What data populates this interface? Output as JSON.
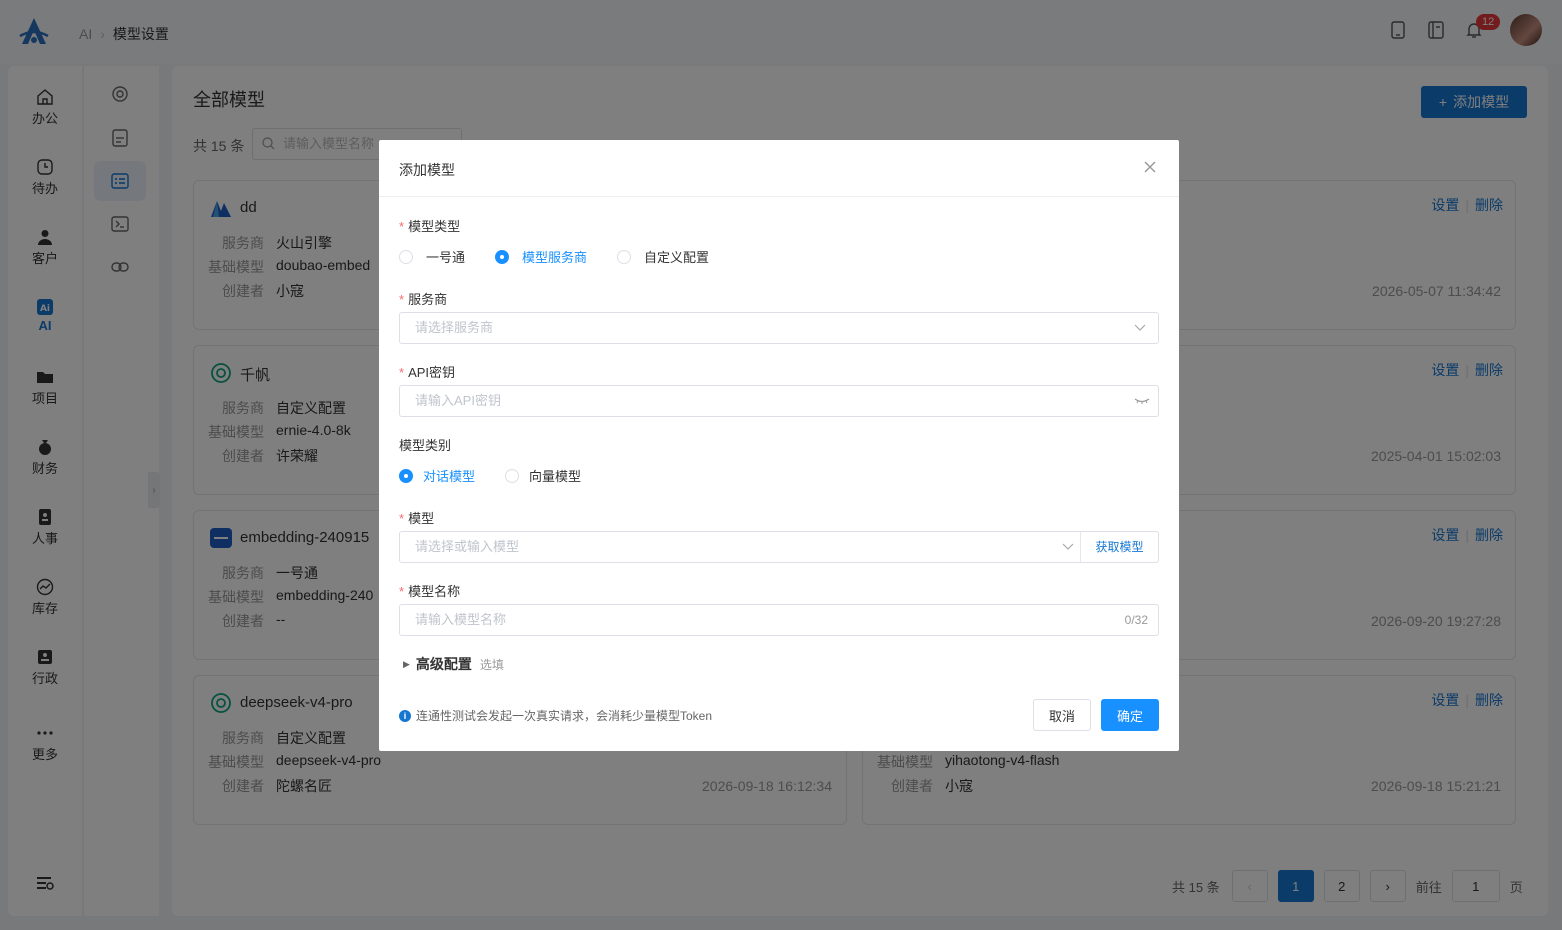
{
  "breadcrumb": {
    "root": "AI",
    "current": "模型设置"
  },
  "notifications": {
    "count": "12"
  },
  "nav": [
    {
      "label": "办公",
      "icon": "home-icon"
    },
    {
      "label": "待办",
      "icon": "clock-icon"
    },
    {
      "label": "客户",
      "icon": "user-icon"
    },
    {
      "label": "AI",
      "icon": "ai-icon"
    },
    {
      "label": "项目",
      "icon": "folder-icon"
    },
    {
      "label": "财务",
      "icon": "money-bag-icon"
    },
    {
      "label": "人事",
      "icon": "badge-icon"
    },
    {
      "label": "库存",
      "icon": "chart-icon"
    },
    {
      "label": "行政",
      "icon": "id-card-icon"
    },
    {
      "label": "更多",
      "icon": "more-icon"
    }
  ],
  "page": {
    "title": "全部模型",
    "add_label": "添加模型",
    "total": "共 15 条",
    "search_placeholder": "请输入模型名称"
  },
  "labels": {
    "provider": "服务商",
    "base_model": "基础模型",
    "creator": "创建者",
    "settings": "设置",
    "delete": "删除"
  },
  "cards": [
    {
      "name": "dd",
      "provider": "火山引擎",
      "base_model": "doubao-embed",
      "creator": "小寇",
      "time": "2026-05-07 11:34:42"
    },
    {
      "name": "千帆",
      "provider": "自定义配置",
      "base_model": "ernie-4.0-8k",
      "creator": "许荣耀",
      "time": "2025-04-01 15:02:03"
    },
    {
      "name": "embedding-240915",
      "provider": "一号通",
      "base_model": "embedding-240",
      "creator": "--",
      "time": "2026-09-20 19:27:28"
    },
    {
      "name": "deepseek-v4-pro",
      "provider": "自定义配置",
      "base_model": "deepseek-v4-pro",
      "creator": "陀螺名匠",
      "time": "2026-09-18 16:12:34"
    }
  ],
  "right_cards": [
    {
      "time": "",
      "base_model": "",
      "creator": ""
    },
    {
      "time": "",
      "base_model": "",
      "creator": ""
    },
    {
      "time": "",
      "base_model": "",
      "creator": ""
    },
    {
      "time": "2026-09-18 15:21:21",
      "base_model": "yihaotong-v4-flash",
      "creator": "小寇"
    }
  ],
  "pagination": {
    "total": "共 15 条",
    "pages": [
      "1",
      "2"
    ],
    "goto_label": "前往",
    "goto_value": "1",
    "page_suffix": "页"
  },
  "modal": {
    "title": "添加模型",
    "model_type_label": "模型类型",
    "model_type_options": [
      "一号通",
      "模型服务商",
      "自定义配置"
    ],
    "model_type_selected": "模型服务商",
    "provider_label": "服务商",
    "provider_placeholder": "请选择服务商",
    "api_key_label": "API密钥",
    "api_key_placeholder": "请输入API密钥",
    "category_label": "模型类别",
    "category_options": [
      "对话模型",
      "向量模型"
    ],
    "category_selected": "对话模型",
    "model_label": "模型",
    "model_placeholder": "请选择或输入模型",
    "fetch_label": "获取模型",
    "name_label": "模型名称",
    "name_placeholder": "请输入模型名称",
    "name_counter": "0/32",
    "advanced_label": "高级配置",
    "advanced_hint": "选填",
    "tip": "连通性测试会发起一次真实请求，会消耗少量模型Token",
    "cancel_label": "取消",
    "ok_label": "确定"
  },
  "colors": {
    "primary": "#1677d2",
    "required": "#f56c6c",
    "badge": "#e4393c"
  }
}
